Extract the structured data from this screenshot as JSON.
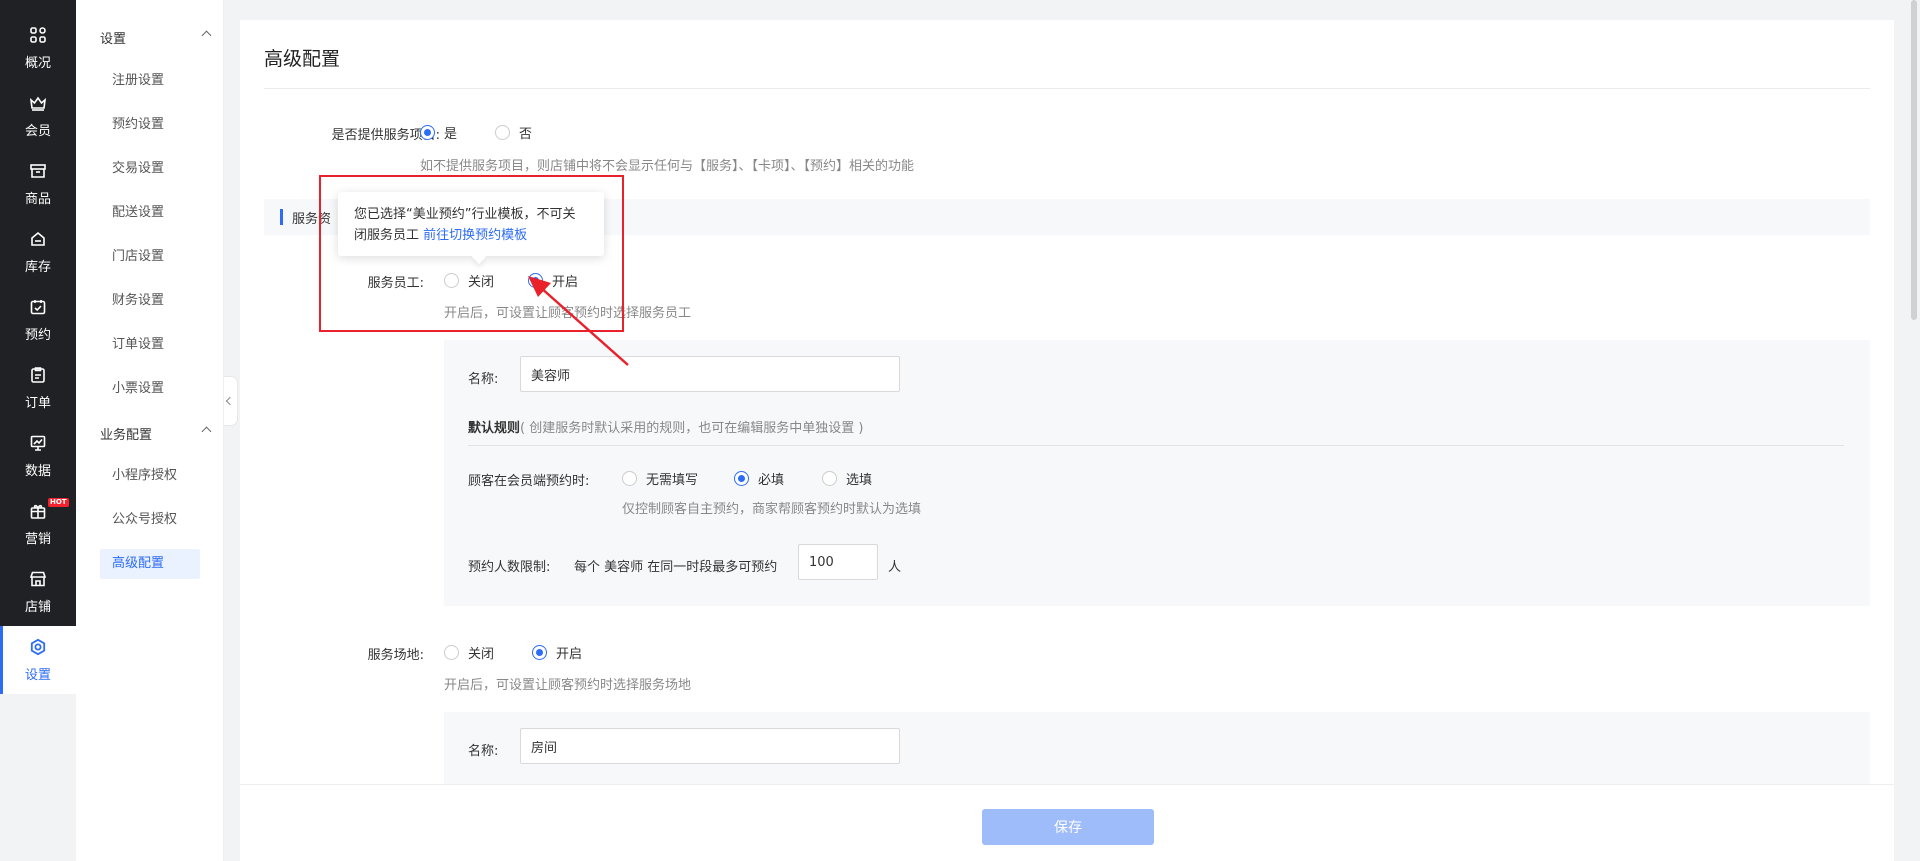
{
  "nav": [
    {
      "label": "概况",
      "icon": "grid-icon"
    },
    {
      "label": "会员",
      "icon": "crown-icon"
    },
    {
      "label": "商品",
      "icon": "store-box-icon"
    },
    {
      "label": "库存",
      "icon": "inventory-icon"
    },
    {
      "label": "预约",
      "icon": "calendar-check-icon"
    },
    {
      "label": "订单",
      "icon": "clipboard-icon"
    },
    {
      "label": "数据",
      "icon": "chart-icon"
    },
    {
      "label": "营销",
      "icon": "gift-icon",
      "badge": "HOT"
    },
    {
      "label": "店铺",
      "icon": "shop-icon"
    },
    {
      "label": "设置",
      "icon": "gear-icon"
    }
  ],
  "subnav": {
    "group1": "设置",
    "group1_items": [
      "注册设置",
      "预约设置",
      "交易设置",
      "配送设置",
      "门店设置",
      "财务设置",
      "订单设置",
      "小票设置"
    ],
    "group2": "业务配置",
    "group2_items": [
      "小程序授权",
      "公众号授权",
      "高级配置"
    ]
  },
  "page": {
    "title": "高级配置",
    "provide_service": {
      "label": "是否提供服务项目:",
      "yes": "是",
      "no": "否",
      "hint": "如不提供服务项目，则店铺中将不会显示任何与【服务】、【卡项】、【预约】相关的功能"
    },
    "section_title": "服务资",
    "staff": {
      "label": "服务员工:",
      "off": "关闭",
      "on": "开启",
      "hint": "开启后，可设置让顾客预约时选择服务员工",
      "name_label": "名称:",
      "name_value": "美容师",
      "rule_title": "默认规则",
      "rule_desc": "( 创建服务时默认采用的规则，也可在编辑服务中单独设置 )",
      "member_label": "顾客在会员端预约时:",
      "opt_none": "无需填写",
      "opt_required": "必填",
      "opt_optional": "选填",
      "member_hint": "仅控制顾客自主预约，商家帮顾客预约时默认为选填",
      "limit_label": "预约人数限制:",
      "limit_text": "每个 美容师 在同一时段最多可预约",
      "limit_value": "100",
      "limit_unit": "人"
    },
    "venue": {
      "label": "服务场地:",
      "off": "关闭",
      "on": "开启",
      "hint": "开启后，可设置让顾客预约时选择服务场地",
      "name_label": "名称:",
      "name_value": "房间"
    },
    "popover": {
      "text": "您已选择“美业预约”行业模板，不可关闭服务员工",
      "link": "前往切换预约模板"
    },
    "save": "保存"
  },
  "colors": {
    "accent": "#2d6cf6",
    "annotation": "#e8212b",
    "nav_bg": "#1f2124"
  }
}
